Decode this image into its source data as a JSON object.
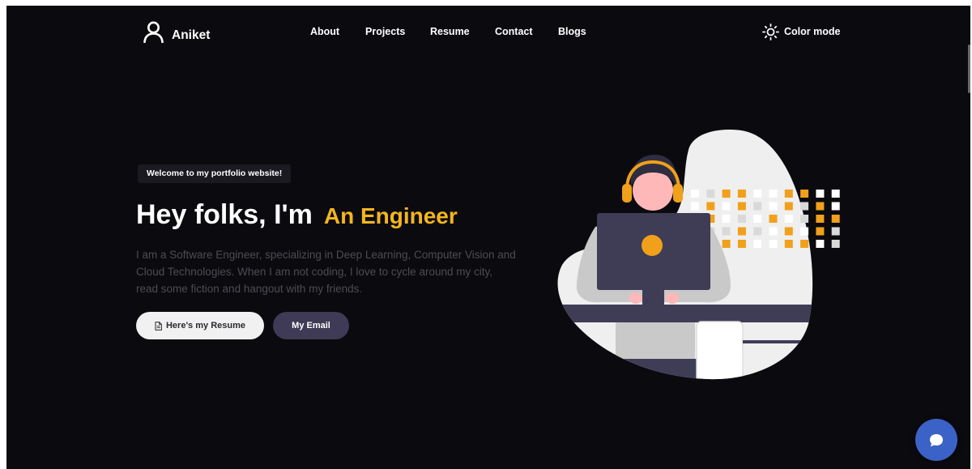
{
  "nav": {
    "brand": "Aniket",
    "brand_icon": "user-icon",
    "links": [
      "About",
      "Projects",
      "Resume",
      "Contact",
      "Blogs"
    ],
    "color_mode": {
      "label": "Color mode",
      "icon": "sun-icon"
    }
  },
  "hero": {
    "badge": "Welcome to my portfolio website!",
    "heading": {
      "prefix": "Hey folks, I'm",
      "highlight": "An Engineer"
    },
    "description_lines": [
      "I am a Software Engineer, specializing in Deep Learning, Computer Vision and",
      "Cloud Technologies. When I am not coding, I love to cycle around my city,",
      "read some fiction and hangout with my friends."
    ],
    "buttons": {
      "resume": {
        "label": "Here's my Resume",
        "icon": "document-icon"
      },
      "email": {
        "label": "My Email"
      }
    }
  },
  "chat_widget": {
    "icon": "chat-bubble-icon"
  },
  "colors": {
    "page_bg": "#0b0a0e",
    "accent": "#f3b61f",
    "email_button": "#3f3a55",
    "chat_button": "#3b62c6",
    "illustration_orange": "#f0a01a",
    "illustration_dark": "#3f3d56"
  }
}
